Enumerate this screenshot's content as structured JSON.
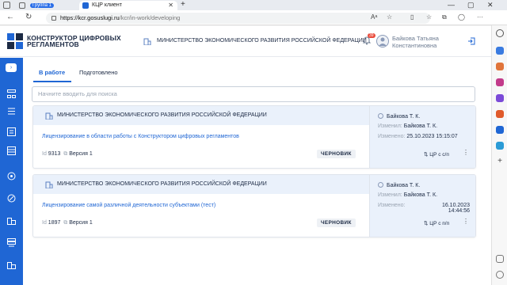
{
  "browser": {
    "tabs": [
      {
        "label": "Группа 1"
      },
      {
        "label": "КЦР клиент"
      }
    ],
    "url_host": "https://kcr.gosuslugi.ru",
    "url_path": "/kcr/in-work/developing"
  },
  "header": {
    "brand_line1": "КОНСТРУКТОР ЦИФРОВЫХ",
    "brand_line2": "РЕГЛАМЕНТОВ",
    "ministry": "МИНИСТЕРСТВО ЭКОНОМИЧЕСКОГО РАЗВИТИЯ РОССИЙСКОЙ ФЕДЕРАЦИИ",
    "notification_count": "39",
    "user_line1": "Байкова Татьяна",
    "user_line2": "Константиновна"
  },
  "content": {
    "tabs": [
      {
        "label": "В работе"
      },
      {
        "label": "Подготовлено"
      }
    ],
    "search_placeholder": "Начните вводить для поиска"
  },
  "cards": [
    {
      "org": "МИНИСТЕРСТВО ЭКОНОМИЧЕСКОГО РАЗВИТИЯ РОССИЙСКОЙ ФЕДЕРАЦИИ",
      "title": "Лицензирование в области работы с Конструктором цифровых регламентов",
      "id_label": "Id",
      "id": "9313",
      "version": "Версия 1",
      "status": "ЧЕРНОВИК",
      "author": "Байкова Т. К.",
      "changed_by_label": "Изменил:",
      "changed_by": "Байкова Т. К.",
      "changed_label": "Изменено:",
      "changed": "25.10.2023 15:15:07",
      "checkpoint": "ЦР с с/п"
    },
    {
      "org": "МИНИСТЕРСТВО ЭКОНОМИЧЕСКОГО РАЗВИТИЯ РОССИЙСКОЙ ФЕДЕРАЦИИ",
      "title": "Лицензирование самой различной деятельности субъектами (тест)",
      "id_label": "Id",
      "id": "1897",
      "version": "Версия 1",
      "status": "ЧЕРНОВИК",
      "author": "Байкова Т. К.",
      "changed_by_label": "Изменил:",
      "changed_by": "Байкова Т. К.",
      "changed_label": "Изменено:",
      "changed_date": "16.10.2023",
      "changed_time": "14:44:56",
      "checkpoint": "ЦР с п/п"
    }
  ],
  "colors": {
    "primary": "#1f66d4",
    "card_header": "#eaf1fb",
    "notification": "#e94c3d"
  }
}
